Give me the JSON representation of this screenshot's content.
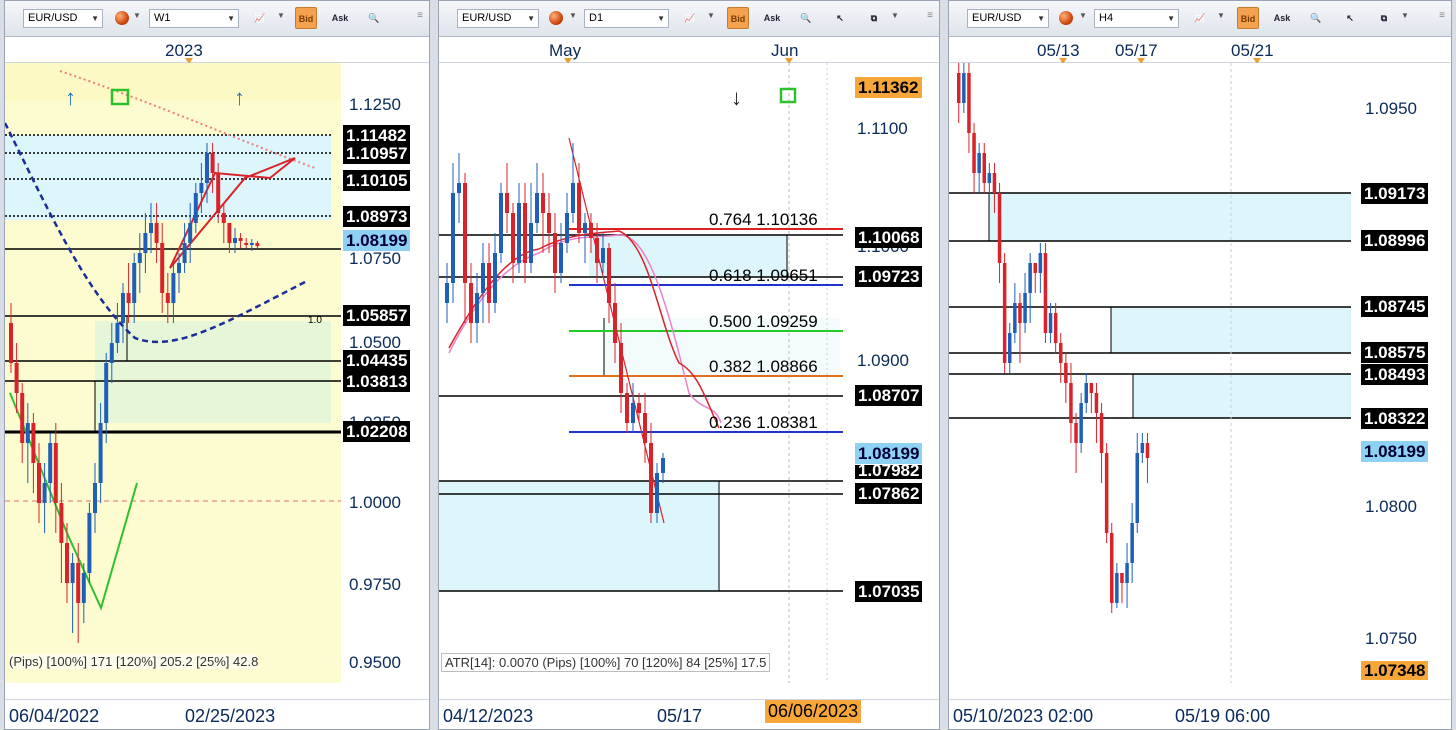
{
  "panels": [
    {
      "symbol": "EUR/USD",
      "timeframe": "W1",
      "btn_bid": "Bid",
      "btn_ask": "Ask",
      "header_label": "2023",
      "axis": [
        "1.1250",
        "1.0750",
        "1.0500",
        "1.0250",
        "1.0000",
        "0.9750",
        "0.9500"
      ],
      "price_boxes": [
        "1.11482",
        "1.10957",
        "1.10105",
        "1.08973",
        "1.08199",
        "1.05857",
        "1.04435",
        "1.03813",
        "1.02208"
      ],
      "atr_text": "(Pips) [100%] 171  [120%] 205.2  [25%] 42.8",
      "date_left": "06/04/2022",
      "date_right": "02/25/2023",
      "mini_label": "1.0"
    },
    {
      "symbol": "EUR/USD",
      "timeframe": "D1",
      "btn_bid": "Bid",
      "btn_ask": "Ask",
      "header_labels": [
        "May",
        "Jun"
      ],
      "axis": [
        "1.1100",
        "1.1000",
        "1.0900"
      ],
      "price_boxes": [
        "1.11362",
        "1.10068",
        "1.09723",
        "1.08707",
        "1.08199",
        "1.07982",
        "1.07862",
        "1.07035"
      ],
      "fib": [
        "0.764 1.10136",
        "0.618 1.09651",
        "0.500 1.09259",
        "0.382 1.08866",
        "0.236 1.08381"
      ],
      "atr_text": "ATR[14]: 0.0070 (Pips) [100%] 70  [120%] 84  [25%] 17.5",
      "date_left": "04/12/2023",
      "date_mid": "05/17",
      "date_badge": "06/06/2023"
    },
    {
      "symbol": "EUR/USD",
      "timeframe": "H4",
      "btn_bid": "Bid",
      "btn_ask": "Ask",
      "header_labels": [
        "05/13",
        "05/17",
        "05/21"
      ],
      "axis": [
        "1.0950",
        "1.0800",
        "1.0750"
      ],
      "price_boxes": [
        "1.09173",
        "1.08996",
        "1.08745",
        "1.08575",
        "1.08493",
        "1.08322",
        "1.08199",
        "1.07348"
      ],
      "date_left": "05/10/2023 02:00",
      "date_right": "05/19 06:00"
    }
  ],
  "colors": {
    "bull": "#1f5fb8",
    "bear": "#d8232a",
    "zone": "#dcf6fb",
    "yellow": "#fdfbd0"
  }
}
